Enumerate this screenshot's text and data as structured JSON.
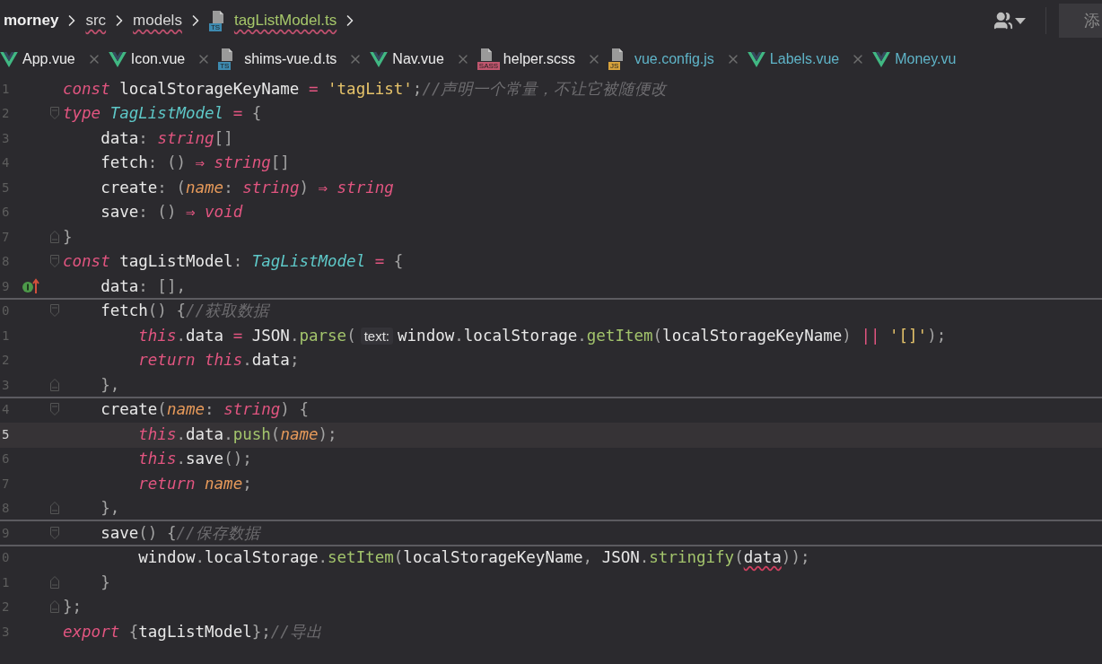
{
  "breadcrumbs": [
    {
      "label": "morney",
      "kind": "project",
      "underlined": false
    },
    {
      "label": "src",
      "kind": "folder",
      "underlined": true
    },
    {
      "label": "models",
      "kind": "folder",
      "underlined": true
    },
    {
      "label": "tagListModel.ts",
      "kind": "ts",
      "icon_label": "TS",
      "underlined": true
    }
  ],
  "toolbar": {
    "action_button": "添"
  },
  "tabs": [
    {
      "label": "App.vue",
      "kind": "vue",
      "modified": false
    },
    {
      "label": "Icon.vue",
      "kind": "vue",
      "modified": false
    },
    {
      "label": "shims-vue.d.ts",
      "kind": "ts",
      "icon_label": "TS",
      "modified": false
    },
    {
      "label": "Nav.vue",
      "kind": "vue",
      "modified": false
    },
    {
      "label": "helper.scss",
      "kind": "sass",
      "icon_label": "SASS",
      "modified": false
    },
    {
      "label": "vue.config.js",
      "kind": "js",
      "icon_label": "JS",
      "modified": true
    },
    {
      "label": "Labels.vue",
      "kind": "vue",
      "modified": true
    },
    {
      "label": "Money.vu",
      "kind": "vue",
      "modified": true
    }
  ],
  "lines": [
    {
      "number": "1",
      "current": false,
      "separator_below": false,
      "tokens": [
        {
          "kind": "keyword",
          "t": "const"
        },
        {
          "kind": "plain",
          "t": " localStorageKeyName "
        },
        {
          "kind": "operator",
          "t": "="
        },
        {
          "kind": "string",
          "t": " 'tagList'"
        },
        {
          "kind": "punct",
          "t": ";"
        },
        {
          "kind": "comment",
          "t": "//声明一个常量，不让它被随便改"
        }
      ]
    },
    {
      "number": "2",
      "current": false,
      "separator_below": false,
      "fold_open": true,
      "tokens": [
        {
          "kind": "keyword",
          "t": "type"
        },
        {
          "kind": "type",
          "t": " TagListModel"
        },
        {
          "kind": "operator",
          "t": " ="
        },
        {
          "kind": "punct",
          "t": " {"
        }
      ]
    },
    {
      "number": "3",
      "current": false,
      "separator_below": false,
      "tokens": [
        {
          "kind": "plain",
          "t": "    data"
        },
        {
          "kind": "punct",
          "t": ": "
        },
        {
          "kind": "keyword",
          "t": "string"
        },
        {
          "kind": "punct",
          "t": "[]"
        }
      ]
    },
    {
      "number": "4",
      "current": false,
      "separator_below": false,
      "tokens": [
        {
          "kind": "plain",
          "t": "    fetch"
        },
        {
          "kind": "punct",
          "t": ": () "
        },
        {
          "kind": "operator",
          "t": "⇒"
        },
        {
          "kind": "keyword",
          "t": " string"
        },
        {
          "kind": "punct",
          "t": "[]"
        }
      ]
    },
    {
      "number": "5",
      "current": false,
      "separator_below": false,
      "tokens": [
        {
          "kind": "plain",
          "t": "    create"
        },
        {
          "kind": "punct",
          "t": ": ("
        },
        {
          "kind": "param",
          "t": "name"
        },
        {
          "kind": "punct",
          "t": ": "
        },
        {
          "kind": "keyword",
          "t": "string"
        },
        {
          "kind": "punct",
          "t": ") "
        },
        {
          "kind": "operator",
          "t": "⇒"
        },
        {
          "kind": "keyword",
          "t": " string"
        }
      ]
    },
    {
      "number": "6",
      "current": false,
      "separator_below": false,
      "tokens": [
        {
          "kind": "plain",
          "t": "    save"
        },
        {
          "kind": "punct",
          "t": ": () "
        },
        {
          "kind": "operator",
          "t": "⇒"
        },
        {
          "kind": "keyword",
          "t": " void"
        }
      ]
    },
    {
      "number": "7",
      "current": false,
      "separator_below": false,
      "fold_close": true,
      "tokens": [
        {
          "kind": "punct",
          "t": "}"
        }
      ]
    },
    {
      "number": "8",
      "current": false,
      "separator_below": false,
      "fold_open": true,
      "tokens": [
        {
          "kind": "keyword",
          "t": "const"
        },
        {
          "kind": "plain",
          "t": " tagListModel"
        },
        {
          "kind": "punct",
          "t": ": "
        },
        {
          "kind": "type",
          "t": "TagListModel"
        },
        {
          "kind": "operator",
          "t": " ="
        },
        {
          "kind": "punct",
          "t": " {"
        }
      ]
    },
    {
      "number": "9",
      "current": false,
      "separator_below": true,
      "implemented": true,
      "tokens": [
        {
          "kind": "plain",
          "t": "    data"
        },
        {
          "kind": "punct",
          "t": ": [],"
        }
      ]
    },
    {
      "number": "0",
      "current": false,
      "separator_below": false,
      "fold_open": true,
      "tokens": [
        {
          "kind": "plain",
          "t": "    fetch"
        },
        {
          "kind": "punct",
          "t": "() {"
        },
        {
          "kind": "comment",
          "t": "//获取数据"
        }
      ]
    },
    {
      "number": "1",
      "current": false,
      "separator_below": false,
      "tokens": [
        {
          "kind": "keyword",
          "t": "        this"
        },
        {
          "kind": "punct",
          "t": "."
        },
        {
          "kind": "plain",
          "t": "data "
        },
        {
          "kind": "operator",
          "t": "="
        },
        {
          "kind": "plain",
          "t": " JSON"
        },
        {
          "kind": "punct",
          "t": "."
        },
        {
          "kind": "function",
          "t": "parse"
        },
        {
          "kind": "punct",
          "t": "("
        },
        {
          "kind": "hint",
          "t": "text:"
        },
        {
          "kind": "plain",
          "t": "window"
        },
        {
          "kind": "punct",
          "t": "."
        },
        {
          "kind": "plain",
          "t": "localStorage"
        },
        {
          "kind": "punct",
          "t": "."
        },
        {
          "kind": "function",
          "t": "getItem"
        },
        {
          "kind": "punct",
          "t": "("
        },
        {
          "kind": "plain",
          "t": "localStorageKeyName"
        },
        {
          "kind": "punct",
          "t": ")"
        },
        {
          "kind": "operator",
          "t": " ||"
        },
        {
          "kind": "string",
          "t": " '[]'"
        },
        {
          "kind": "punct",
          "t": ");"
        }
      ]
    },
    {
      "number": "2",
      "current": false,
      "separator_below": false,
      "tokens": [
        {
          "kind": "keyword",
          "t": "        return this"
        },
        {
          "kind": "punct",
          "t": "."
        },
        {
          "kind": "plain",
          "t": "data"
        },
        {
          "kind": "punct",
          "t": ";"
        }
      ]
    },
    {
      "number": "3",
      "current": false,
      "separator_below": true,
      "fold_close": true,
      "tokens": [
        {
          "kind": "punct",
          "t": "    },"
        }
      ]
    },
    {
      "number": "4",
      "current": false,
      "separator_below": false,
      "fold_open": true,
      "tokens": [
        {
          "kind": "plain",
          "t": "    create"
        },
        {
          "kind": "punct",
          "t": "("
        },
        {
          "kind": "param",
          "t": "name"
        },
        {
          "kind": "punct",
          "t": ": "
        },
        {
          "kind": "keyword",
          "t": "string"
        },
        {
          "kind": "punct",
          "t": ") {"
        }
      ]
    },
    {
      "number": "5",
      "current": true,
      "separator_below": false,
      "tokens": [
        {
          "kind": "keyword",
          "t": "        this"
        },
        {
          "kind": "punct",
          "t": "."
        },
        {
          "kind": "plain",
          "t": "data"
        },
        {
          "kind": "punct",
          "t": "."
        },
        {
          "kind": "function",
          "t": "push"
        },
        {
          "kind": "punct",
          "t": "("
        },
        {
          "kind": "param",
          "t": "name"
        },
        {
          "kind": "punct",
          "t": ");"
        }
      ]
    },
    {
      "number": "6",
      "current": false,
      "separator_below": false,
      "tokens": [
        {
          "kind": "keyword",
          "t": "        this"
        },
        {
          "kind": "punct",
          "t": "."
        },
        {
          "kind": "plain",
          "t": "save"
        },
        {
          "kind": "punct",
          "t": "();"
        }
      ]
    },
    {
      "number": "7",
      "current": false,
      "separator_below": false,
      "tokens": [
        {
          "kind": "keyword",
          "t": "        return"
        },
        {
          "kind": "param",
          "t": " name"
        },
        {
          "kind": "punct",
          "t": ";"
        }
      ]
    },
    {
      "number": "8",
      "current": false,
      "separator_below": true,
      "fold_close": true,
      "tokens": [
        {
          "kind": "punct",
          "t": "    },"
        }
      ]
    },
    {
      "number": "9",
      "current": false,
      "separator_below": true,
      "fold_open": true,
      "tokens": [
        {
          "kind": "plain",
          "t": "    save"
        },
        {
          "kind": "punct",
          "t": "() {"
        },
        {
          "kind": "comment",
          "t": "//保存数据"
        }
      ]
    },
    {
      "number": "0",
      "current": false,
      "separator_below": false,
      "tokens": [
        {
          "kind": "plain",
          "t": "        window"
        },
        {
          "kind": "punct",
          "t": "."
        },
        {
          "kind": "plain",
          "t": "localStorage"
        },
        {
          "kind": "punct",
          "t": "."
        },
        {
          "kind": "function",
          "t": "setItem"
        },
        {
          "kind": "punct",
          "t": "("
        },
        {
          "kind": "plain",
          "t": "localStorageKeyName"
        },
        {
          "kind": "punct",
          "t": ","
        },
        {
          "kind": "plain",
          "t": " JSON"
        },
        {
          "kind": "punct",
          "t": "."
        },
        {
          "kind": "function",
          "t": "stringify"
        },
        {
          "kind": "punct",
          "t": "("
        },
        {
          "kind": "error",
          "t": "data"
        },
        {
          "kind": "punct",
          "t": "));"
        }
      ]
    },
    {
      "number": "1",
      "current": false,
      "separator_below": false,
      "fold_close": true,
      "tokens": [
        {
          "kind": "punct",
          "t": "    }"
        }
      ]
    },
    {
      "number": "2",
      "current": false,
      "separator_below": false,
      "fold_close": true,
      "tokens": [
        {
          "kind": "punct",
          "t": "};"
        }
      ]
    },
    {
      "number": "3",
      "current": false,
      "separator_below": false,
      "tokens": [
        {
          "kind": "keyword",
          "t": "export"
        },
        {
          "kind": "punct",
          "t": " {"
        },
        {
          "kind": "plain",
          "t": "tagListModel"
        },
        {
          "kind": "punct",
          "t": "};"
        },
        {
          "kind": "comment",
          "t": "//导出"
        }
      ]
    }
  ]
}
